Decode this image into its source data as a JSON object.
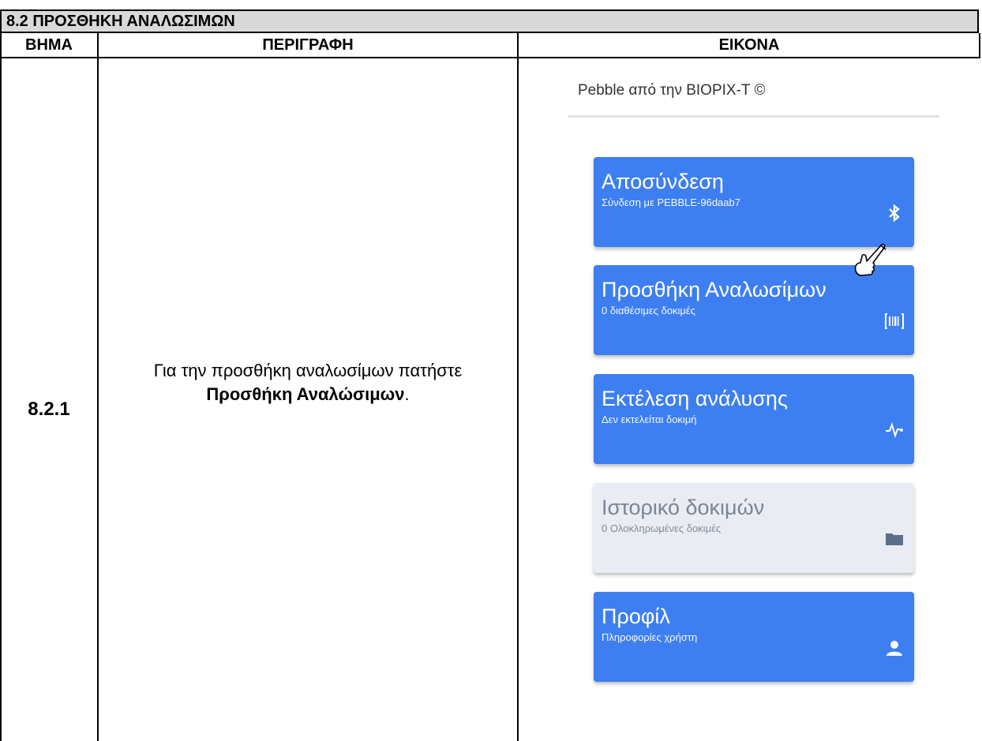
{
  "section": {
    "title": "8.2 ΠΡΟΣΘΗΚΗ ΑΝΑΛΩΣΙΜΩΝ"
  },
  "headers": {
    "step": "ΒΗΜΑ",
    "description": "ΠΕΡΙΓΡΑΦΗ",
    "image": "ΕΙΚΟΝΑ"
  },
  "row": {
    "step": "8.2.1",
    "description_plain": "Για την προσθήκη αναλωσίμων πατήστε",
    "description_bold": "Προσθήκη Αναλώσιμων",
    "description_end": "."
  },
  "phone": {
    "title": "Pebble από την BIOPIX-T ©",
    "cards": [
      {
        "title": "Αποσύνδεση",
        "subtitle": "Σύνδεση με PEBBLE-96daab7",
        "icon": "bluetooth-icon",
        "enabled": true
      },
      {
        "title": "Προσθήκη Αναλωσίμων",
        "subtitle": "0 διαθέσιμες δοκιμές",
        "icon": "barcode-icon",
        "enabled": true
      },
      {
        "title": "Εκτέλεση ανάλυσης",
        "subtitle": "Δεν εκτελείται δοκιμή",
        "icon": "pulse-icon",
        "enabled": true
      },
      {
        "title": "Ιστορικό δοκιμών",
        "subtitle": "0 Ολοκληρωμένες δοκιμές",
        "icon": "folder-icon",
        "enabled": false
      },
      {
        "title": "Προφίλ",
        "subtitle": "Πληροφορίες χρήστη",
        "icon": "person-icon",
        "enabled": true
      }
    ]
  },
  "colors": {
    "card_blue": "#3d7ff0",
    "card_disabled": "#e9edf3",
    "header_gray": "#d9d9d9"
  }
}
